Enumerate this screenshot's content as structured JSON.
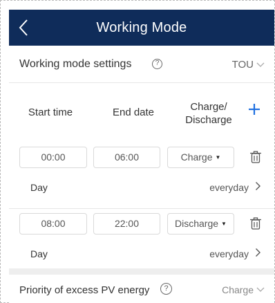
{
  "header": {
    "title": "Working Mode",
    "back_icon": "chevron-left-icon"
  },
  "working_mode": {
    "label": "Working mode settings",
    "value": "TOU"
  },
  "columns": {
    "start": "Start time",
    "end": "End date",
    "charge_line1": "Charge/",
    "charge_line2": "Discharge"
  },
  "slots": [
    {
      "start": "00:00",
      "end": "06:00",
      "mode": "Charge",
      "day_label": "Day",
      "day_value": "everyday"
    },
    {
      "start": "08:00",
      "end": "22:00",
      "mode": "Discharge",
      "day_label": "Day",
      "day_value": "everyday"
    }
  ],
  "priority": {
    "label": "Priority of excess PV energy",
    "value": "Charge"
  },
  "colors": {
    "header_bg": "#0f2c5a",
    "accent": "#1e6fe0"
  }
}
